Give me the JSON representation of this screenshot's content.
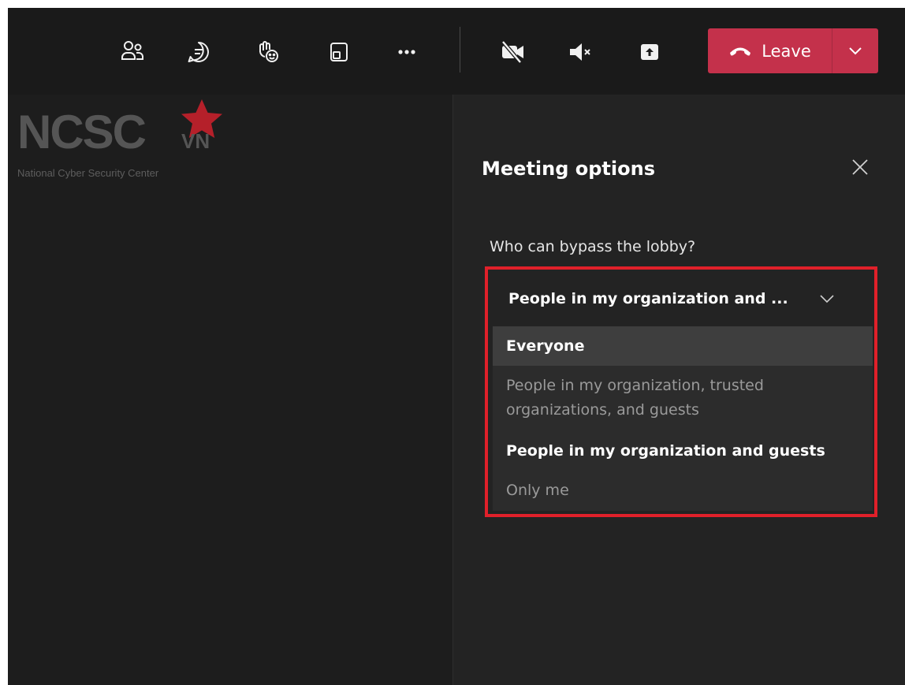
{
  "toolbar": {
    "icons": [
      "people-icon",
      "chat-icon",
      "react-icon",
      "rooms-icon",
      "more-icon",
      "camera-off-icon",
      "mic-muted-icon",
      "share-icon"
    ],
    "leave_label": "Leave",
    "leave_color": "#c4314b"
  },
  "logo": {
    "main": "NCSC",
    "suffix": "VN",
    "subtitle": "National Cyber Security Center",
    "star_color": "#b5202a"
  },
  "panel": {
    "title": "Meeting options",
    "question": "Who can bypass the lobby?",
    "selected_value": "People in my organization and ...",
    "options": [
      "Everyone",
      "People in my organization, trusted organizations, and guests",
      "People in my organization and guests",
      "Only me"
    ],
    "highlight_color": "#e0202a"
  }
}
